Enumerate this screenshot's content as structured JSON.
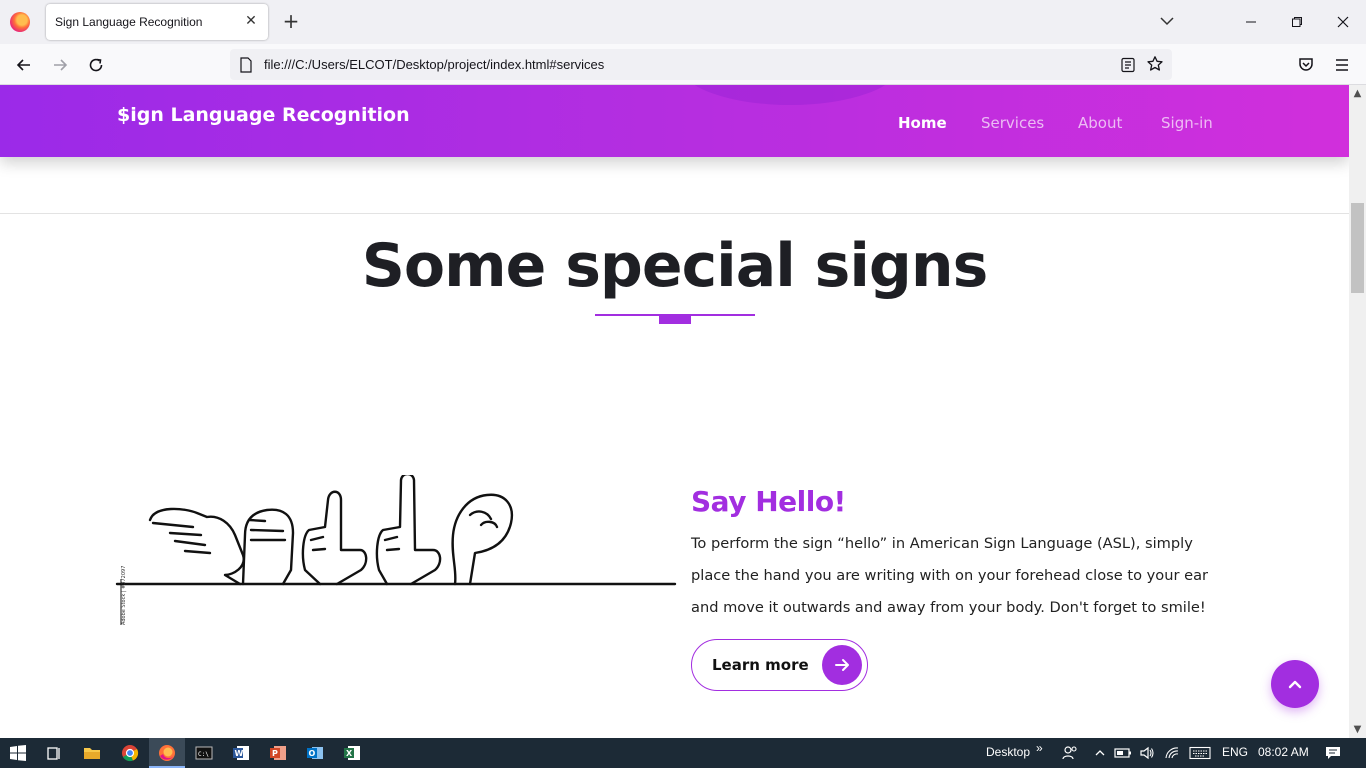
{
  "browser": {
    "tab_title": "Sign Language Recognition",
    "url": "file:///C:/Users/ELCOT/Desktop/project/index.html#services"
  },
  "header": {
    "brand": "$ign Language Recognition",
    "menu": [
      {
        "label": "Home",
        "active": true
      },
      {
        "label": "Services",
        "active": false
      },
      {
        "label": "About",
        "active": false
      },
      {
        "label": "Sign-in",
        "active": false
      }
    ]
  },
  "section": {
    "title": "Some special signs"
  },
  "card": {
    "heading": "Say Hello!",
    "text": "To perform the sign “hello” in American Sign Language (ASL), simply place the hand you are writing with on your forehead close to your ear and move it outwards and away from your body. Don't forget to smile!",
    "button_label": "Learn more",
    "image_caption": "Adobe Stock | #372097"
  },
  "taskbar": {
    "desktop_label": "Desktop",
    "language": "ENG",
    "time": "08:02 AM",
    "apps": [
      "start-icon",
      "task-view-icon",
      "file-explorer-icon",
      "chrome-icon",
      "firefox-icon",
      "cmd-icon",
      "word-icon",
      "powerpoint-icon",
      "outlook-icon",
      "excel-icon"
    ]
  },
  "colors": {
    "accent": "#a22ee0",
    "header_gradient_start": "#9b2ae8",
    "header_gradient_end": "#d12fdc",
    "title_text": "#1e1f24"
  }
}
